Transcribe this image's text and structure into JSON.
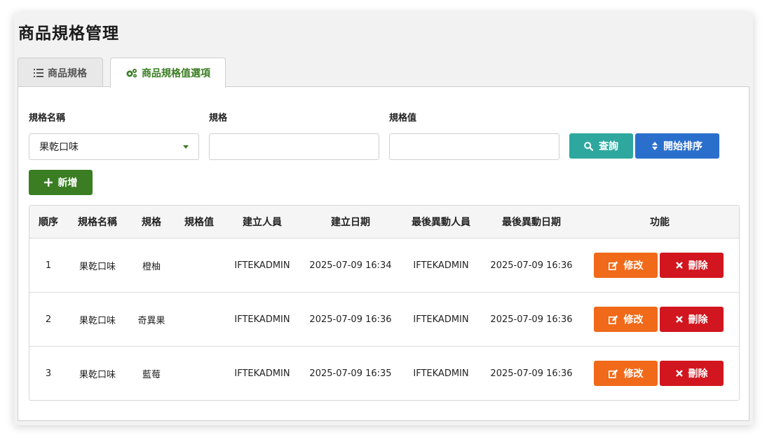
{
  "page_title": "商品規格管理",
  "tabs": [
    {
      "label": "商品規格",
      "icon": "list-icon"
    },
    {
      "label": "商品規格值選項",
      "icon": "cogs-icon"
    }
  ],
  "filters": {
    "spec_name_label": "規格名稱",
    "spec_name_value": "果乾口味",
    "spec_label": "規格",
    "spec_value": "",
    "spec_val_label": "規格值",
    "spec_val_value": ""
  },
  "buttons": {
    "query": "查詢",
    "sort": "開始排序",
    "add": "新增",
    "edit": "修改",
    "delete": "刪除"
  },
  "table": {
    "headers": [
      "順序",
      "規格名稱",
      "規格",
      "規格值",
      "建立人員",
      "建立日期",
      "最後異動人員",
      "最後異動日期",
      "功能"
    ],
    "rows": [
      [
        "1",
        "果乾口味",
        "橙柚",
        "",
        "IFTEKADMIN",
        "2025-07-09 16:34",
        "IFTEKADMIN",
        "2025-07-09 16:36"
      ],
      [
        "2",
        "果乾口味",
        "奇異果",
        "",
        "IFTEKADMIN",
        "2025-07-09 16:36",
        "IFTEKADMIN",
        "2025-07-09 16:36"
      ],
      [
        "3",
        "果乾口味",
        "藍莓",
        "",
        "IFTEKADMIN",
        "2025-07-09 16:35",
        "IFTEKADMIN",
        "2025-07-09 16:36"
      ]
    ]
  },
  "colors": {
    "primary_green": "#3a7d22",
    "teal": "#2ea89e",
    "blue": "#2a6fcc",
    "orange": "#f06a1a",
    "red": "#d1161f"
  }
}
